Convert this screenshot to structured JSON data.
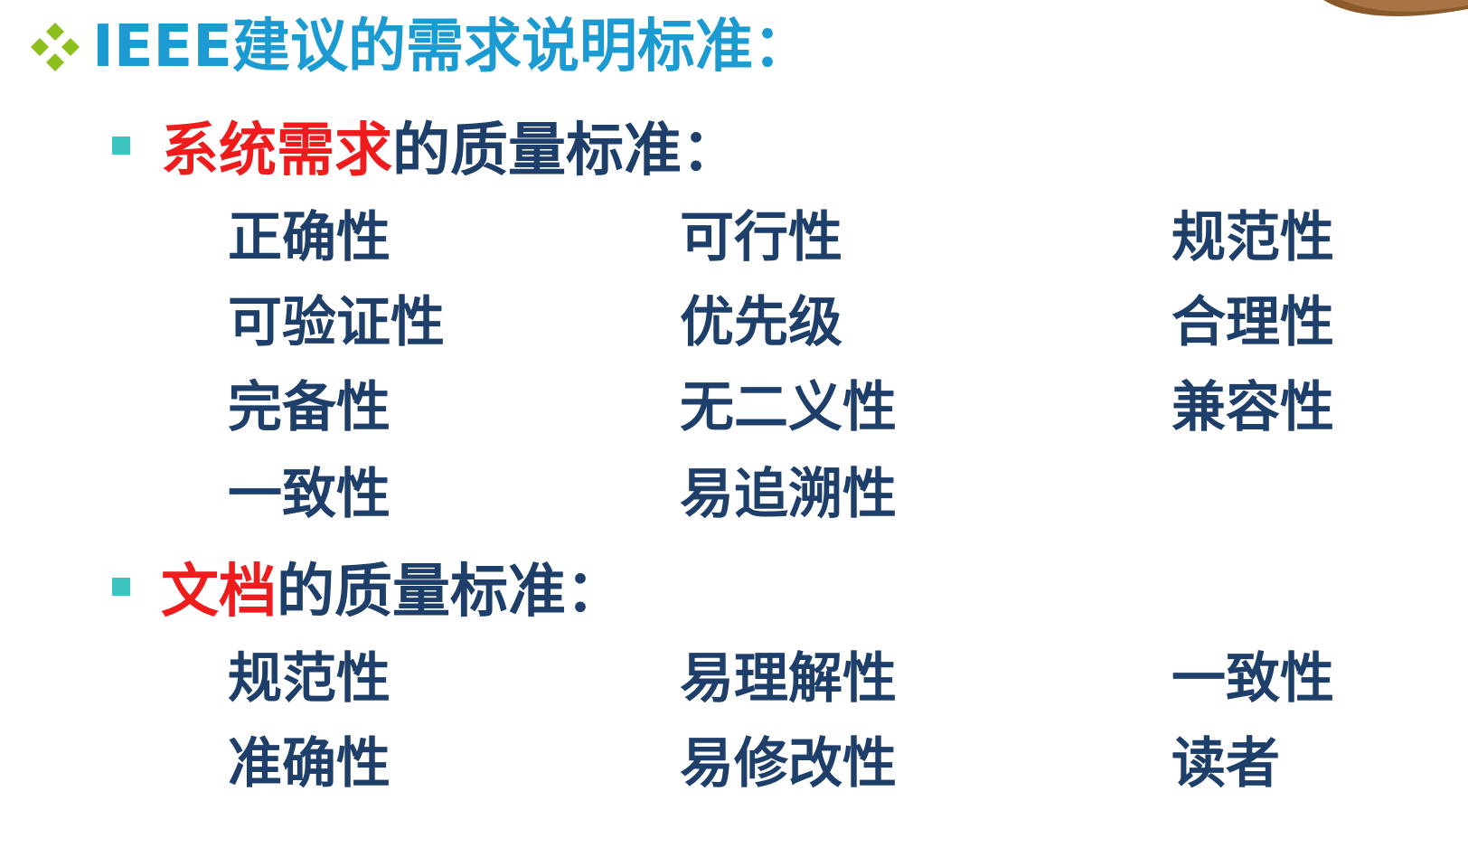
{
  "title": "IEEE建议的需求说明标准：",
  "sections": [
    {
      "highlight": "系统需求",
      "rest": "的质量标准：",
      "rows": [
        [
          "正确性",
          "可行性",
          "规范性"
        ],
        [
          "可验证性",
          "优先级",
          "合理性"
        ],
        [
          "完备性",
          "无二义性",
          "兼容性"
        ],
        [
          "一致性",
          "易追溯性",
          ""
        ]
      ]
    },
    {
      "highlight": "文档",
      "rest": "的质量标准：",
      "rows": [
        [
          "规范性",
          "易理解性",
          "一致性"
        ],
        [
          "准确性",
          "易修改性",
          "读者"
        ]
      ]
    }
  ],
  "colors": {
    "title": "#1b9bd1",
    "highlight": "#ee1c1c",
    "body_text": "#1f3f6b",
    "square_bullet": "#3cc4c0",
    "diamond_bullet": "#8dbf1e",
    "corner_decoration": "#8b5a2b"
  },
  "icons": {
    "title_bullet": "four-diamond-icon",
    "section_bullet": "square-bullet-icon"
  }
}
